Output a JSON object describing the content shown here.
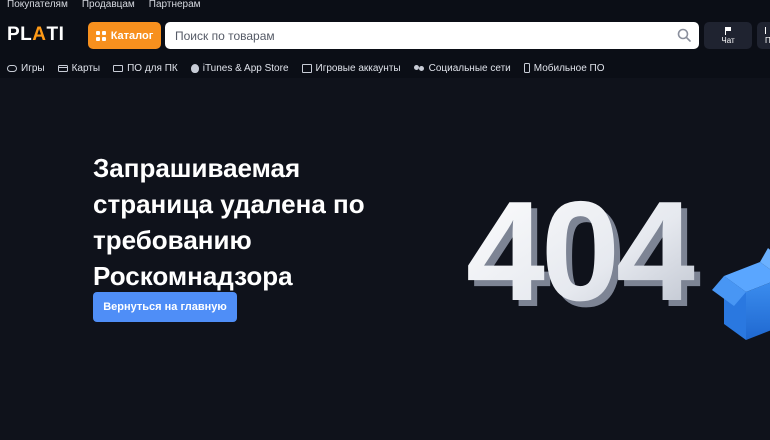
{
  "top_links": [
    "Покупателям",
    "Продавцам",
    "Партнерам"
  ],
  "header": {
    "logo_text_pre": "PL",
    "logo_text_accent": "A",
    "logo_text_post": "TI",
    "catalog_label": "Каталог",
    "search_placeholder": "Поиск по товарам",
    "chat_label": "Чат",
    "extra_label": "П"
  },
  "category_nav": [
    {
      "label": "Игры",
      "icon": "gamepad-icon"
    },
    {
      "label": "Карты",
      "icon": "card-icon"
    },
    {
      "label": "ПО для ПК",
      "icon": "pc-icon"
    },
    {
      "label": "iTunes & App Store",
      "icon": "apple-icon"
    },
    {
      "label": "Игровые аккаунты",
      "icon": "account-icon"
    },
    {
      "label": "Социальные сети",
      "icon": "people-icon"
    },
    {
      "label": "Мобильное ПО",
      "icon": "mobile-icon"
    }
  ],
  "hero": {
    "title_lines": [
      "Запрашиваемая",
      "страница удалена по",
      "требованию",
      "Роскомнадзора"
    ],
    "button_label": "Вернуться на главную",
    "error_code": "404"
  },
  "colors": {
    "background": "#0f121b",
    "accent_orange": "#f7901e",
    "button_blue": "#4f8ef7"
  }
}
